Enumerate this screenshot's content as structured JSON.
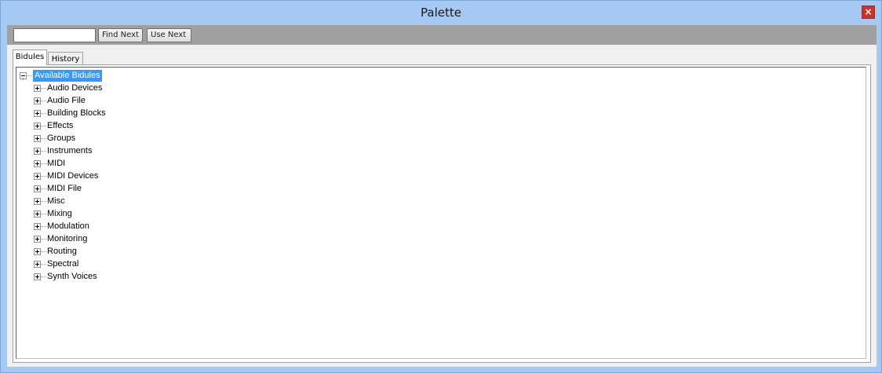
{
  "window": {
    "title": "Palette",
    "close_glyph": "×"
  },
  "toolbar": {
    "search_value": "",
    "find_next_label": "Find Next",
    "use_next_label": "Use Next"
  },
  "tabs": [
    {
      "label": "Bidules",
      "active": true
    },
    {
      "label": "History",
      "active": false
    }
  ],
  "tree": {
    "root_label": "Available Bidules",
    "items": [
      {
        "label": "Audio Devices"
      },
      {
        "label": "Audio File"
      },
      {
        "label": "Building Blocks"
      },
      {
        "label": "Effects"
      },
      {
        "label": "Groups"
      },
      {
        "label": "Instruments"
      },
      {
        "label": "MIDI"
      },
      {
        "label": "MIDI Devices"
      },
      {
        "label": "MIDI File"
      },
      {
        "label": "Misc"
      },
      {
        "label": "Mixing"
      },
      {
        "label": "Modulation"
      },
      {
        "label": "Monitoring"
      },
      {
        "label": "Routing"
      },
      {
        "label": "Spectral"
      },
      {
        "label": "Synth Voices"
      }
    ]
  },
  "colors": {
    "window_bg": "#a5c9f3",
    "toolbar_bg": "#a0a0a0",
    "selection": "#3399ff",
    "close_button": "#c8342b"
  }
}
